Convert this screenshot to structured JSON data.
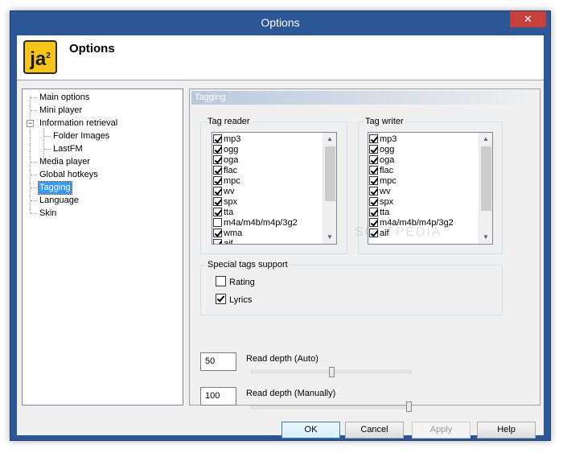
{
  "window": {
    "title": "Options",
    "close_glyph": "✕"
  },
  "header": {
    "logo_text": "ja",
    "logo_sup": "2",
    "title": "Options"
  },
  "tree": {
    "items": [
      {
        "label": "Main options"
      },
      {
        "label": "Mini player"
      },
      {
        "label": "Information retrieval",
        "expander": "−"
      },
      {
        "label": "Folder Images"
      },
      {
        "label": "LastFM"
      },
      {
        "label": "Media player"
      },
      {
        "label": "Global hotkeys"
      },
      {
        "label": "Tagging",
        "selected": true
      },
      {
        "label": "Language"
      },
      {
        "label": "Skin"
      }
    ]
  },
  "panel": {
    "title": "Tagging",
    "tag_reader": {
      "label": "Tag reader",
      "items": [
        {
          "label": "mp3",
          "checked": true
        },
        {
          "label": "ogg",
          "checked": true
        },
        {
          "label": "oga",
          "checked": true
        },
        {
          "label": "flac",
          "checked": true
        },
        {
          "label": "mpc",
          "checked": true
        },
        {
          "label": "wv",
          "checked": true
        },
        {
          "label": "spx",
          "checked": true
        },
        {
          "label": "tta",
          "checked": true
        },
        {
          "label": "m4a/m4b/m4p/3g2",
          "checked": false
        },
        {
          "label": "wma",
          "checked": true
        },
        {
          "label": "aif",
          "checked": true
        }
      ]
    },
    "tag_writer": {
      "label": "Tag writer",
      "items": [
        {
          "label": "mp3",
          "checked": true
        },
        {
          "label": "ogg",
          "checked": true
        },
        {
          "label": "oga",
          "checked": true
        },
        {
          "label": "flac",
          "checked": true
        },
        {
          "label": "mpc",
          "checked": true
        },
        {
          "label": "wv",
          "checked": true
        },
        {
          "label": "spx",
          "checked": true
        },
        {
          "label": "tta",
          "checked": true
        },
        {
          "label": "m4a/m4b/m4p/3g2",
          "checked": true
        },
        {
          "label": "aif",
          "checked": true
        }
      ]
    },
    "special_tags": {
      "label": "Special tags support",
      "rating": {
        "label": "Rating",
        "checked": false
      },
      "lyrics": {
        "label": "Lyrics",
        "checked": true
      }
    },
    "read_depth_auto": {
      "label": "Read depth (Auto)",
      "value": "50",
      "slider_fraction": 0.5
    },
    "read_depth_manual": {
      "label": "Read depth (Manually)",
      "value": "100",
      "slider_fraction": 1.0
    },
    "watermark": "SOFTPEDIA"
  },
  "buttons": {
    "ok": "OK",
    "cancel": "Cancel",
    "apply": "Apply",
    "help": "Help"
  },
  "colors": {
    "titlebar": "#2b5797",
    "close": "#c7413a",
    "selection": "#3399ff"
  }
}
